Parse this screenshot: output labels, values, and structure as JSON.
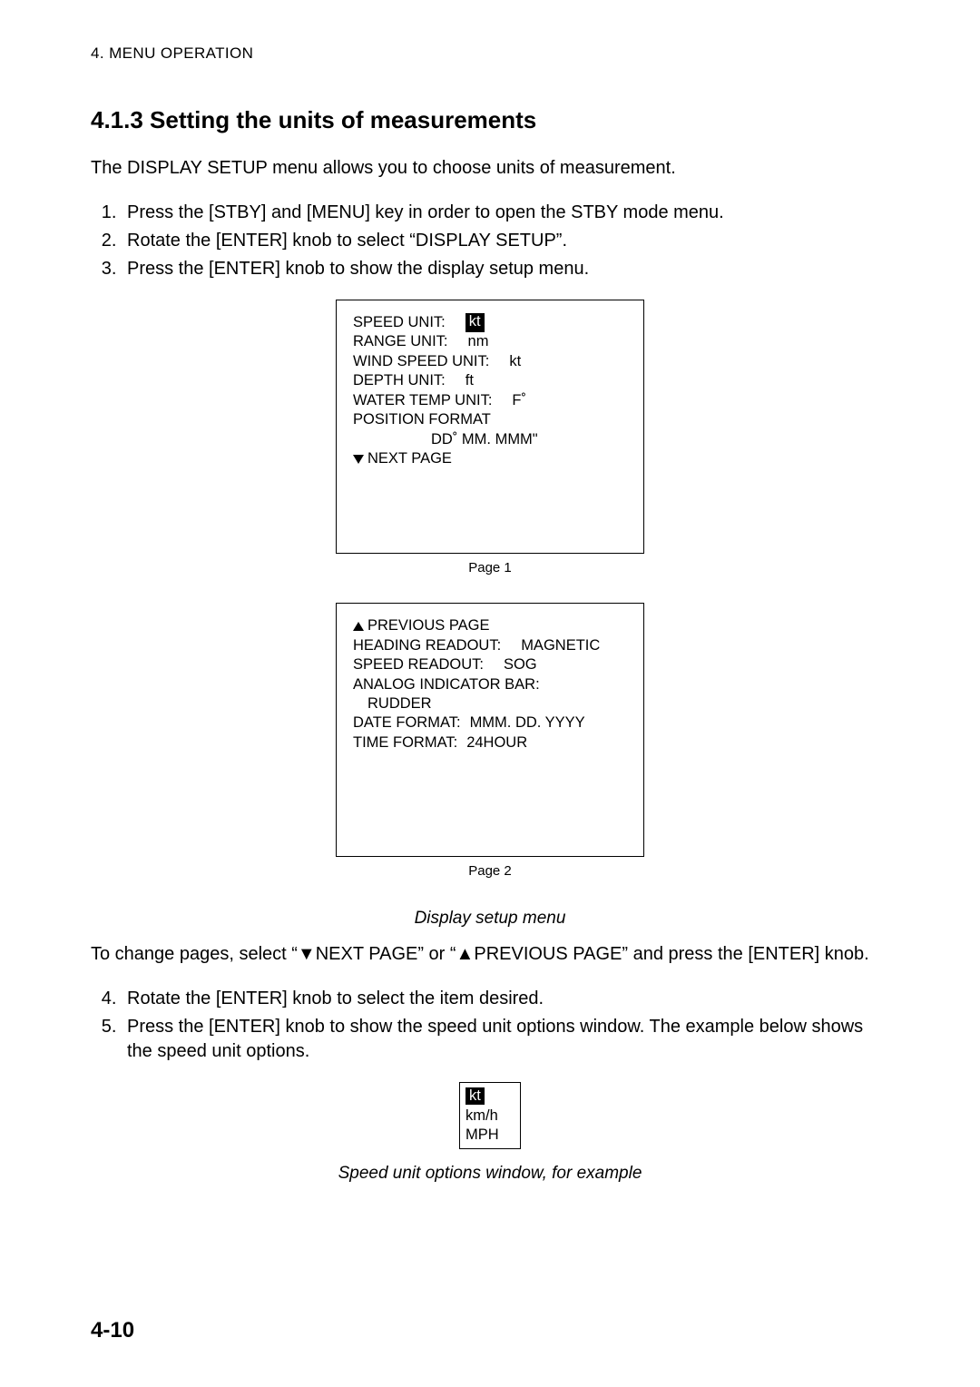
{
  "running_header": "4. MENU OPERATION",
  "heading": "4.1.3   Setting the units of measurements",
  "intro": "The DISPLAY SETUP menu allows you to choose units of measurement.",
  "steps_a": [
    "Press the [STBY] and [MENU] key in order to open the STBY mode menu.",
    "Rotate the [ENTER] knob to select “DISPLAY SETUP”.",
    "Press the [ENTER] knob to show the display setup menu."
  ],
  "screen1": {
    "rows": [
      {
        "label": "SPEED UNIT:",
        "value": "kt",
        "highlight": true
      },
      {
        "label": "RANGE UNIT:",
        "value": "nm"
      },
      {
        "label": "WIND SPEED UNIT:",
        "value": "kt"
      },
      {
        "label": "DEPTH UNIT:",
        "value": "ft"
      },
      {
        "label": "WATER TEMP UNIT:",
        "value": "F˚"
      }
    ],
    "pos_format_label": "POSITION FORMAT",
    "pos_format_value": "DD˚ MM. MMM\"",
    "next_page": "NEXT PAGE",
    "caption": "Page 1"
  },
  "screen2": {
    "previous_page": "PREVIOUS PAGE",
    "rows1": [
      {
        "label": "HEADING READOUT:",
        "value": "MAGNETIC"
      },
      {
        "label": "SPEED READOUT:",
        "value": "SOG"
      }
    ],
    "analog_label": "ANALOG INDICATOR BAR:",
    "analog_value": "RUDDER",
    "rows2": [
      {
        "label": "DATE FORMAT:",
        "value": "MMM. DD. YYYY"
      },
      {
        "label": "TIME FORMAT:",
        "value": "24HOUR"
      }
    ],
    "caption": "Page 2"
  },
  "figure_caption_1": "Display setup menu",
  "para_after": "To change pages, select “▼NEXT PAGE” or “▲PREVIOUS PAGE” and press the [ENTER] knob.",
  "steps_b": [
    "Rotate the [ENTER] knob to select the item desired.",
    "Press the [ENTER] knob to show the speed unit options window. The example below shows the speed unit options."
  ],
  "options_window": {
    "selected": "kt",
    "other": [
      "km/h",
      "MPH"
    ]
  },
  "figure_caption_2": "Speed unit options window, for example",
  "page_number": "4-10"
}
